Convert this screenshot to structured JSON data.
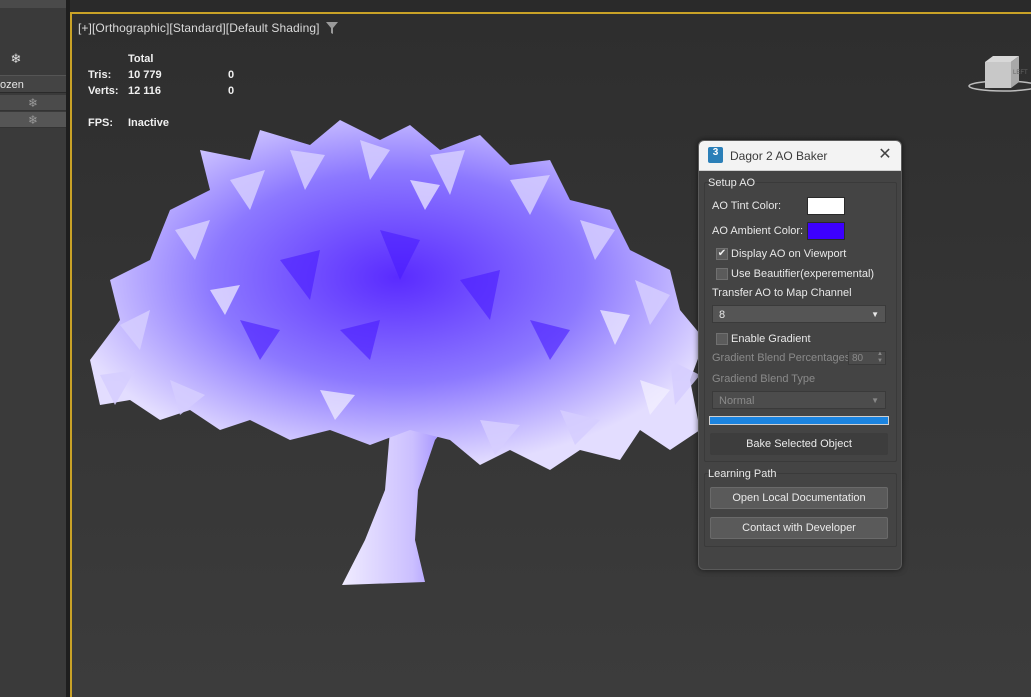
{
  "left_panel": {
    "header": "ozen",
    "rows": [
      "❄",
      "❄"
    ]
  },
  "viewport": {
    "label_parts": [
      "[+]",
      "[Orthographic]",
      "[Standard]",
      "[Default Shading]"
    ],
    "stats": {
      "total_label": "Total",
      "tris_label": "Tris:",
      "tris_total": "10 779",
      "tris_sel": "0",
      "verts_label": "Verts:",
      "verts_total": "12 116",
      "verts_sel": "0",
      "fps_label": "FPS:",
      "fps_value": "Inactive"
    },
    "viewcube_label": "LEFT"
  },
  "dialog": {
    "app_icon_text": "3",
    "title": "Dagor 2 AO Baker",
    "close_glyph": "✕",
    "setup_group": {
      "title": "Setup AO",
      "tint_label": "AO Tint Color:",
      "tint_color": "#ffffff",
      "ambient_label": "AO Ambient Color:",
      "ambient_color": "#3d00ff",
      "display_ao_label": "Display AO on Viewport",
      "display_ao_checked": true,
      "beautifier_label": "Use Beautifier(experemental)",
      "beautifier_checked": false,
      "transfer_label": "Transfer AO to Map Channel",
      "channel_value": "8",
      "gradient_label": "Enable Gradient",
      "gradient_checked": false,
      "blend_pct_label": "Gradient Blend Percentages",
      "blend_pct_value": "80",
      "blend_type_label": "Gradiend Blend Type",
      "blend_type_value": "Normal",
      "progress": 1.0,
      "bake_label": "Bake Selected Object"
    },
    "learning_group": {
      "title": "Learning Path",
      "docs_label": "Open Local Documentation",
      "contact_label": "Contact with Developer"
    },
    "checkmark_glyph": "✔",
    "dropdown_arrow": "▼",
    "spin_up": "▲",
    "spin_down": "▼"
  },
  "colors": {
    "viewport_border": "#c9a227",
    "tree_light": "#e3ddff",
    "tree_mid": "#a08cff",
    "tree_dark": "#3d00ff",
    "progress_fill": "#1b84e0"
  }
}
